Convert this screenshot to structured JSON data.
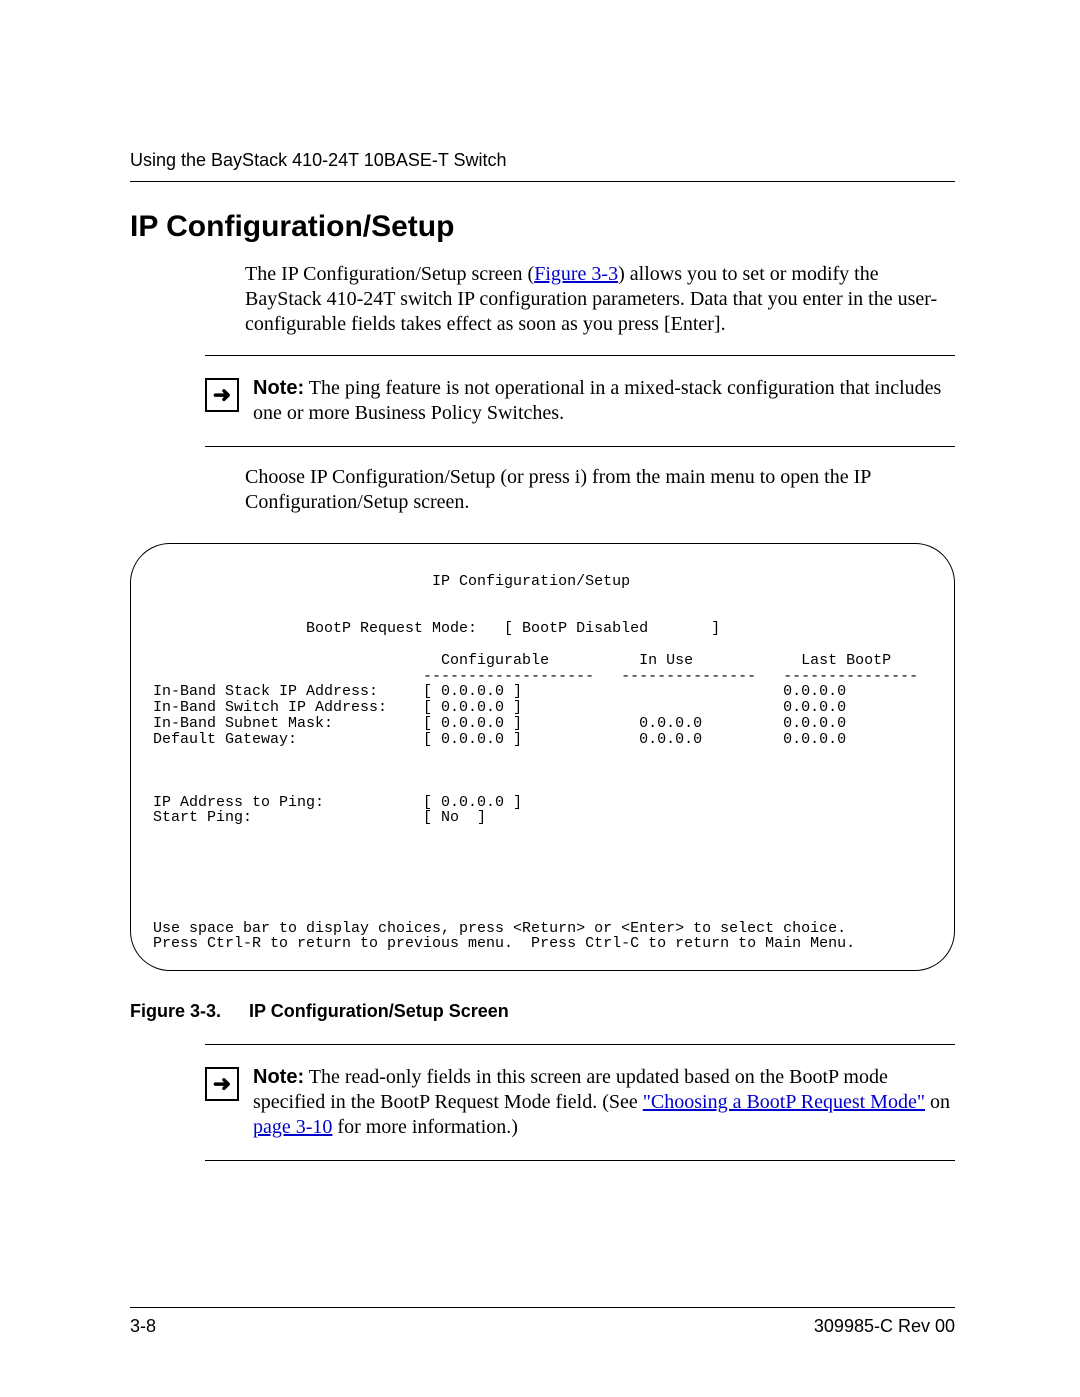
{
  "header": {
    "running_head": "Using the BayStack 410-24T 10BASE-T Switch"
  },
  "section": {
    "title": "IP Configuration/Setup",
    "intro_pre": "The IP Configuration/Setup screen (",
    "intro_link": "Figure 3-3",
    "intro_post": ") allows you to set or modify the BayStack 410-24T switch IP configuration parameters. Data that you enter in the user-configurable fields takes effect as soon as you press [Enter].",
    "note1_label": "Note:",
    "note1_text": " The ping feature is not operational in a mixed-stack configuration that includes one or more Business Policy Switches.",
    "choose_text": "Choose IP Configuration/Setup (or press i) from the main menu to open the IP Configuration/Setup screen."
  },
  "screen": {
    "title": "IP Configuration/Setup",
    "bootp_label": "BootP Request Mode:",
    "bootp_value": "[ BootP Disabled       ]",
    "col1": "Configurable",
    "col2": "In Use",
    "col3": "Last BootP",
    "dash1": "-------------------",
    "dash2": "---------------",
    "dash3": "---------------",
    "rows": [
      {
        "label": "In-Band Stack IP Address:",
        "conf": "[ 0.0.0.0 ]",
        "inuse": "",
        "last": "0.0.0.0"
      },
      {
        "label": "In-Band Switch IP Address:",
        "conf": "[ 0.0.0.0 ]",
        "inuse": "",
        "last": "0.0.0.0"
      },
      {
        "label": "In-Band Subnet Mask:",
        "conf": "[ 0.0.0.0 ]",
        "inuse": "0.0.0.0",
        "last": "0.0.0.0"
      },
      {
        "label": "Default Gateway:",
        "conf": "[ 0.0.0.0 ]",
        "inuse": "0.0.0.0",
        "last": "0.0.0.0"
      }
    ],
    "ping_label": "IP Address to Ping:",
    "ping_value": "[ 0.0.0.0 ]",
    "startping_label": "Start Ping:",
    "startping_value": "[ No  ]",
    "help1": "Use space bar to display choices, press <Return> or <Enter> to select choice.",
    "help2": "Press Ctrl-R to return to previous menu.  Press Ctrl-C to return to Main Menu."
  },
  "figure": {
    "label": "Figure 3-3.",
    "title": "IP Configuration/Setup Screen"
  },
  "note2": {
    "label": "Note:",
    "pre": " The read-only fields in this screen are updated based on the BootP mode specified in the BootP Request Mode field. (See ",
    "link1": "\"Choosing a BootP Request Mode\"",
    "mid": " on ",
    "link2": "page 3-10",
    "post": " for more information.)"
  },
  "footer": {
    "page": "3-8",
    "doc": "309985-C Rev 00"
  }
}
